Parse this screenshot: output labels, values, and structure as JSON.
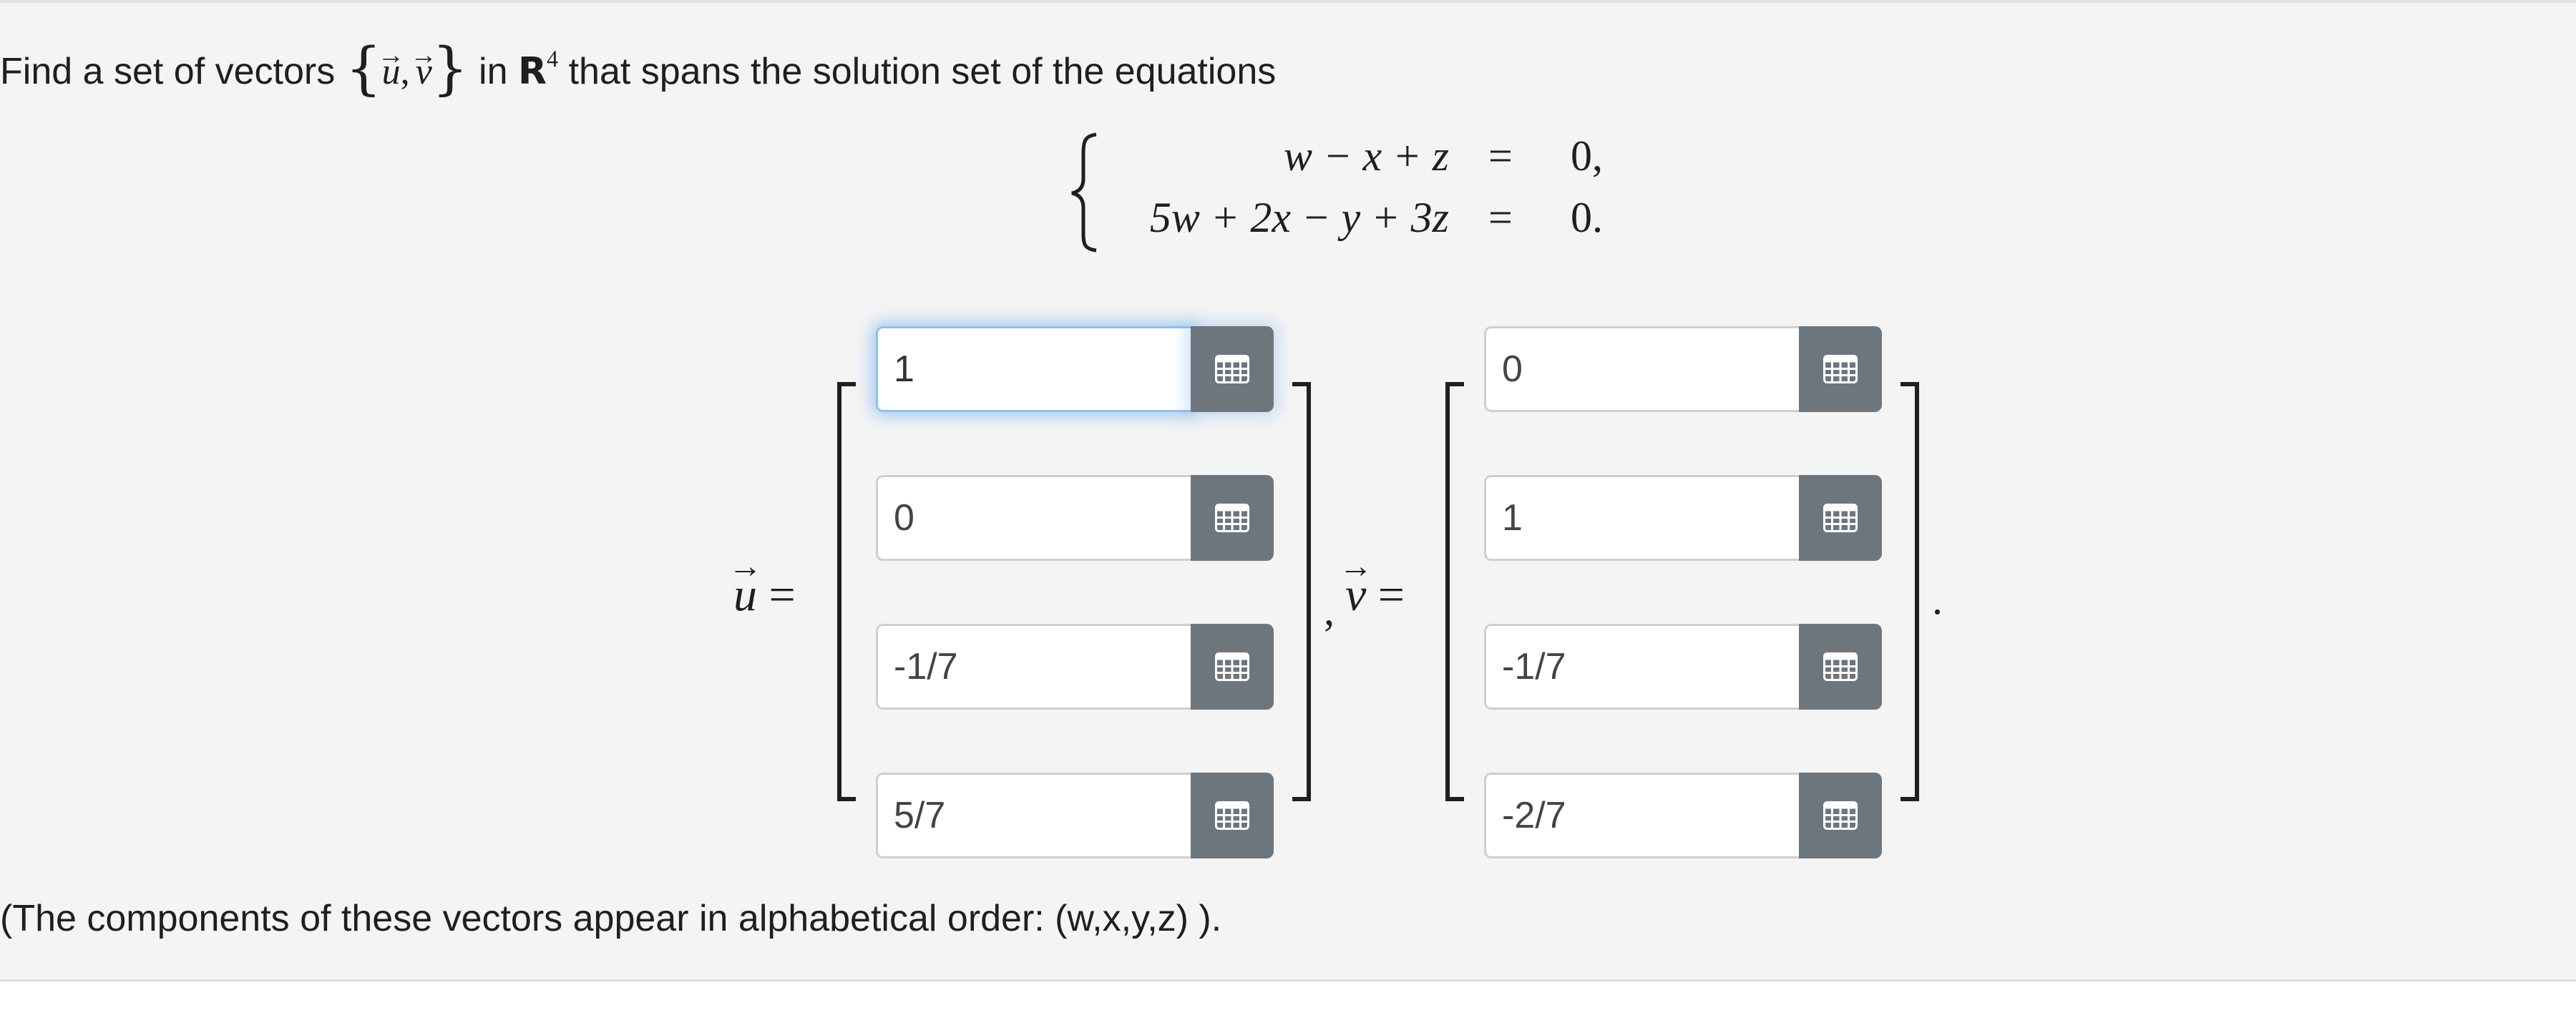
{
  "prompt": {
    "prefix": "Find a set of vectors",
    "set_u": "u",
    "set_comma": ",",
    "set_v": "v",
    "in": "in",
    "space": "R",
    "dim": "4",
    "suffix": "that spans the solution set of the equations"
  },
  "equations": [
    {
      "lhs": "w − x + z",
      "rel": "=",
      "rhs": "0,"
    },
    {
      "lhs": "5w + 2x − y + 3z",
      "rel": "=",
      "rhs": "0."
    }
  ],
  "vector_u": {
    "symbol": "u",
    "eq": "=",
    "entries": [
      "1",
      "0",
      "-1/7",
      "5/7"
    ]
  },
  "separator": ",",
  "vector_v": {
    "symbol": "v",
    "eq": "=",
    "entries": [
      "0",
      "1",
      "-1/7",
      "-2/7"
    ]
  },
  "end_period": ".",
  "footnote": "(The components of these vectors appear in alphabetical order: (w,x,y,z) ).",
  "icons": {
    "matrix_button": "grid-icon"
  },
  "colors": {
    "focus_ring": "#8ec2f5",
    "button_bg": "#6e767d",
    "panel_bg": "#f4f4f4"
  }
}
